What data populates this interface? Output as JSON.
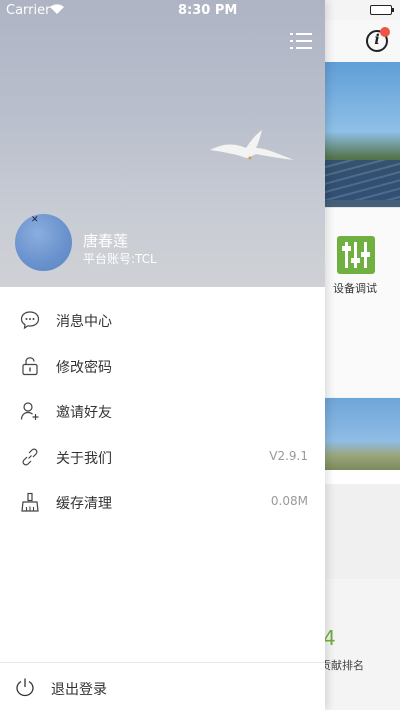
{
  "status_bar": {
    "carrier": "Carrier",
    "time": "8:30 PM"
  },
  "profile": {
    "name": "唐春莲",
    "account": "平台账号:TCL"
  },
  "menu": [
    {
      "label": "消息中心",
      "value": "",
      "icon": "message-icon"
    },
    {
      "label": "修改密码",
      "value": "",
      "icon": "lock-icon"
    },
    {
      "label": "邀请好友",
      "value": "",
      "icon": "add-user-icon"
    },
    {
      "label": "关于我们",
      "value": "V2.9.1",
      "icon": "link-icon"
    },
    {
      "label": "缓存清理",
      "value": "0.08M",
      "icon": "broom-icon"
    }
  ],
  "logout": {
    "label": "退出登录",
    "icon": "power-icon"
  },
  "background_app": {
    "info_icon": "i",
    "debug_label": "设备调试",
    "rank_number": "4",
    "rank_label": "贡献排名"
  },
  "colors": {
    "accent_green": "#6fb040",
    "drawer_bg": "#ffffff",
    "hero_bg": "#b9bfcc"
  }
}
